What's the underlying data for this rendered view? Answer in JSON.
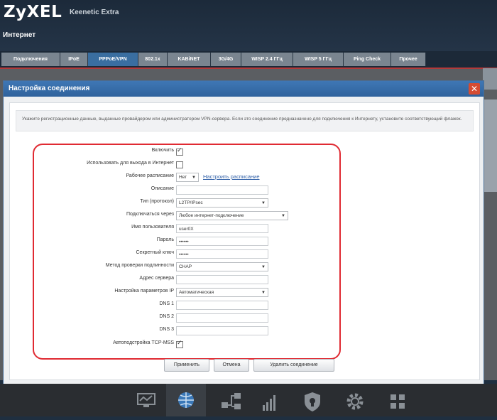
{
  "header": {
    "logo": "ZyXEL",
    "model": "Keenetic Extra",
    "section": "Интернет"
  },
  "tabs": [
    {
      "label": "Подключения"
    },
    {
      "label": "IPoE"
    },
    {
      "label": "PPPoE/VPN"
    },
    {
      "label": "802.1x"
    },
    {
      "label": "KABiNET"
    },
    {
      "label": "3G/4G"
    },
    {
      "label": "WISP 2.4 ГГц"
    },
    {
      "label": "WISP 5 ГГц"
    },
    {
      "label": "Ping Check"
    },
    {
      "label": "Прочее"
    }
  ],
  "dialog": {
    "title": "Настройка соединения",
    "close": "✕",
    "info": "Укажите регистрационные данные, выданные провайдером или администратором VPN-сервера. Если это соединение предназначено для подключения к Интернету, установите соответствующий флажок."
  },
  "form": {
    "enable": {
      "label": "Включить",
      "checked": true
    },
    "use_internet": {
      "label": "Использовать для выхода в Интернет",
      "checked": false
    },
    "schedule": {
      "label": "Рабочее расписание",
      "value": "Нет",
      "link": "Настроить расписание"
    },
    "description": {
      "label": "Описание",
      "value": ""
    },
    "type": {
      "label": "Тип (протокол)",
      "value": "L2TP/IPsec"
    },
    "connect_via": {
      "label": "Подключаться через",
      "value": "Любое интернет-подключение"
    },
    "username": {
      "label": "Имя пользователя",
      "value": "user0X"
    },
    "password": {
      "label": "Пароль",
      "value": "••••••"
    },
    "secret": {
      "label": "Секретный ключ",
      "value": "••••••"
    },
    "auth": {
      "label": "Метод проверки подлинности",
      "value": "CHAP"
    },
    "server": {
      "label": "Адрес сервера",
      "value": ""
    },
    "ip_settings": {
      "label": "Настройка параметров IP",
      "value": "Автоматическая"
    },
    "dns1": {
      "label": "DNS 1",
      "value": ""
    },
    "dns2": {
      "label": "DNS 2",
      "value": ""
    },
    "dns3": {
      "label": "DNS 3",
      "value": ""
    },
    "tcp_mss": {
      "label": "Автоподстройка TCP-MSS",
      "checked": true
    }
  },
  "buttons": {
    "apply": "Применить",
    "cancel": "Отмена",
    "delete": "Удалить соединение"
  },
  "taskbar": [
    {
      "icon": "monitor-icon"
    },
    {
      "icon": "globe-icon"
    },
    {
      "icon": "network-icon"
    },
    {
      "icon": "signal-icon"
    },
    {
      "icon": "shield-icon"
    },
    {
      "icon": "gear-icon"
    },
    {
      "icon": "apps-icon"
    }
  ],
  "colors": {
    "accent": "#2f629c",
    "highlight": "#e02a32",
    "link": "#2f5fa7"
  }
}
